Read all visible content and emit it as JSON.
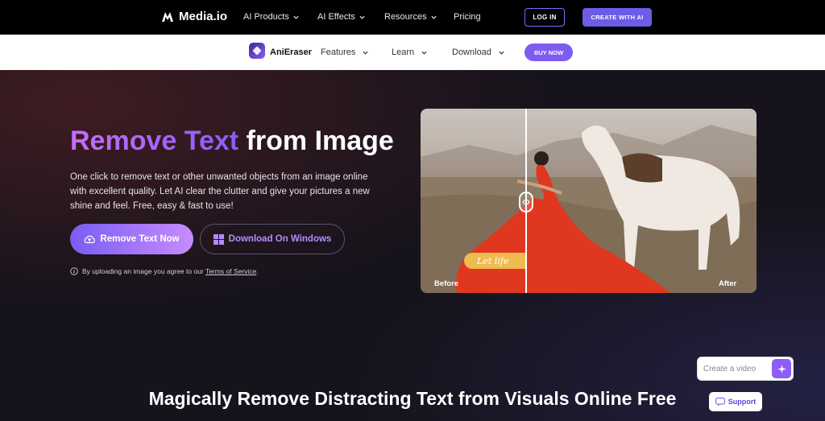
{
  "topnav": {
    "brand": "Media.io",
    "items": [
      {
        "label": "AI Products"
      },
      {
        "label": "AI Effects"
      },
      {
        "label": "Resources"
      },
      {
        "label": "Pricing"
      }
    ],
    "login_label": "LOG IN",
    "create_label": "CREATE WITH AI"
  },
  "subnav": {
    "product": "AniEraser",
    "items": [
      {
        "label": "Features"
      },
      {
        "label": "Learn"
      },
      {
        "label": "Download"
      }
    ],
    "buy_label": "BUY NOW"
  },
  "hero": {
    "title_highlight": "Remove Text",
    "title_rest": " from Image",
    "description": "One click to remove text or other unwanted objects from an image online with excellent quality. Let AI clear the clutter and give your pictures a new shine and feel. Free, easy & fast to use!",
    "primary_button": "Remove Text Now",
    "secondary_button": "Download On Windows",
    "terms_prefix": "By uploading an image you agree to our ",
    "terms_link": "Terms of Service",
    "terms_suffix": "."
  },
  "compare": {
    "before_label": "Before",
    "after_label": "After",
    "overlay_text": "Let life"
  },
  "section": {
    "title": "Magically Remove Distracting Text from Visuals Online Free"
  },
  "widget": {
    "create_placeholder": "Create a video",
    "support_label": "Support"
  },
  "colors": {
    "accent": "#7b5cf3",
    "gradient_end": "#c78cff",
    "background": "#16131c"
  }
}
